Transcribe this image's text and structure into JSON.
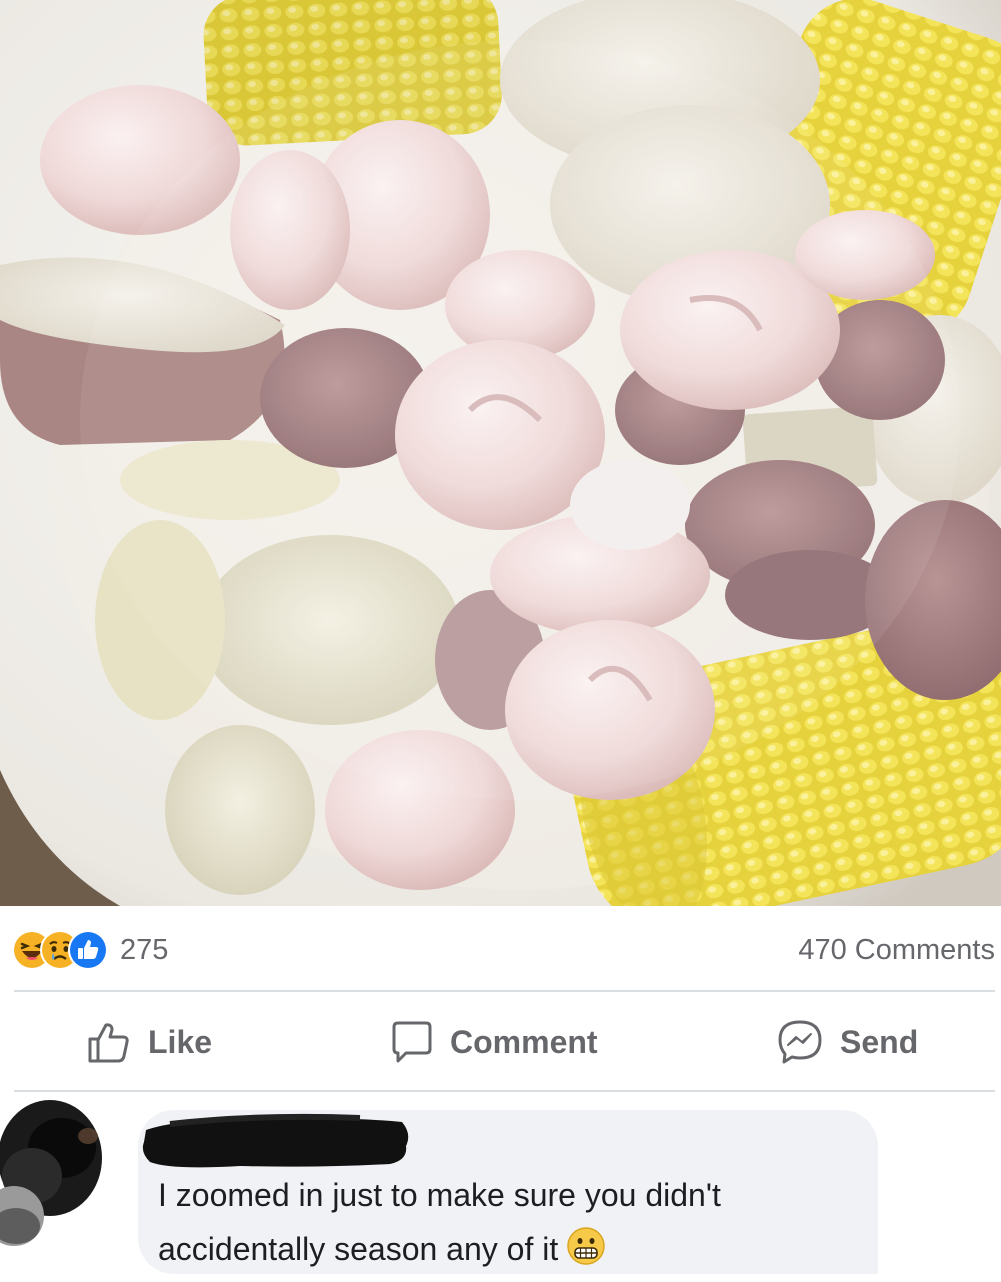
{
  "post": {
    "photo_icon": "food-photo-icon",
    "reactions": [
      {
        "icon": "haha-reaction-icon",
        "color": "#f7b125"
      },
      {
        "icon": "sad-reaction-icon",
        "color": "#f7b125"
      },
      {
        "icon": "like-reaction-icon",
        "color": "#1877f2"
      }
    ],
    "reaction_count": "275",
    "comment_count": "470 Comments"
  },
  "actions": {
    "like": {
      "label": "Like",
      "icon": "thumbs-up-icon"
    },
    "comment": {
      "label": "Comment",
      "icon": "speech-bubble-icon"
    },
    "send": {
      "label": "Send",
      "icon": "messenger-icon"
    }
  },
  "comment": {
    "avatar_icon": "avatar-icon",
    "author_redacted": true,
    "text": "I zoomed in just to make sure you didn't accidentally season any of it",
    "emoji_icon": "grimacing-face-icon"
  },
  "colors": {
    "secondary_text": "#65676b",
    "divider": "#dadde1",
    "bubble": "#f0f2f5",
    "accent": "#1877f2"
  }
}
